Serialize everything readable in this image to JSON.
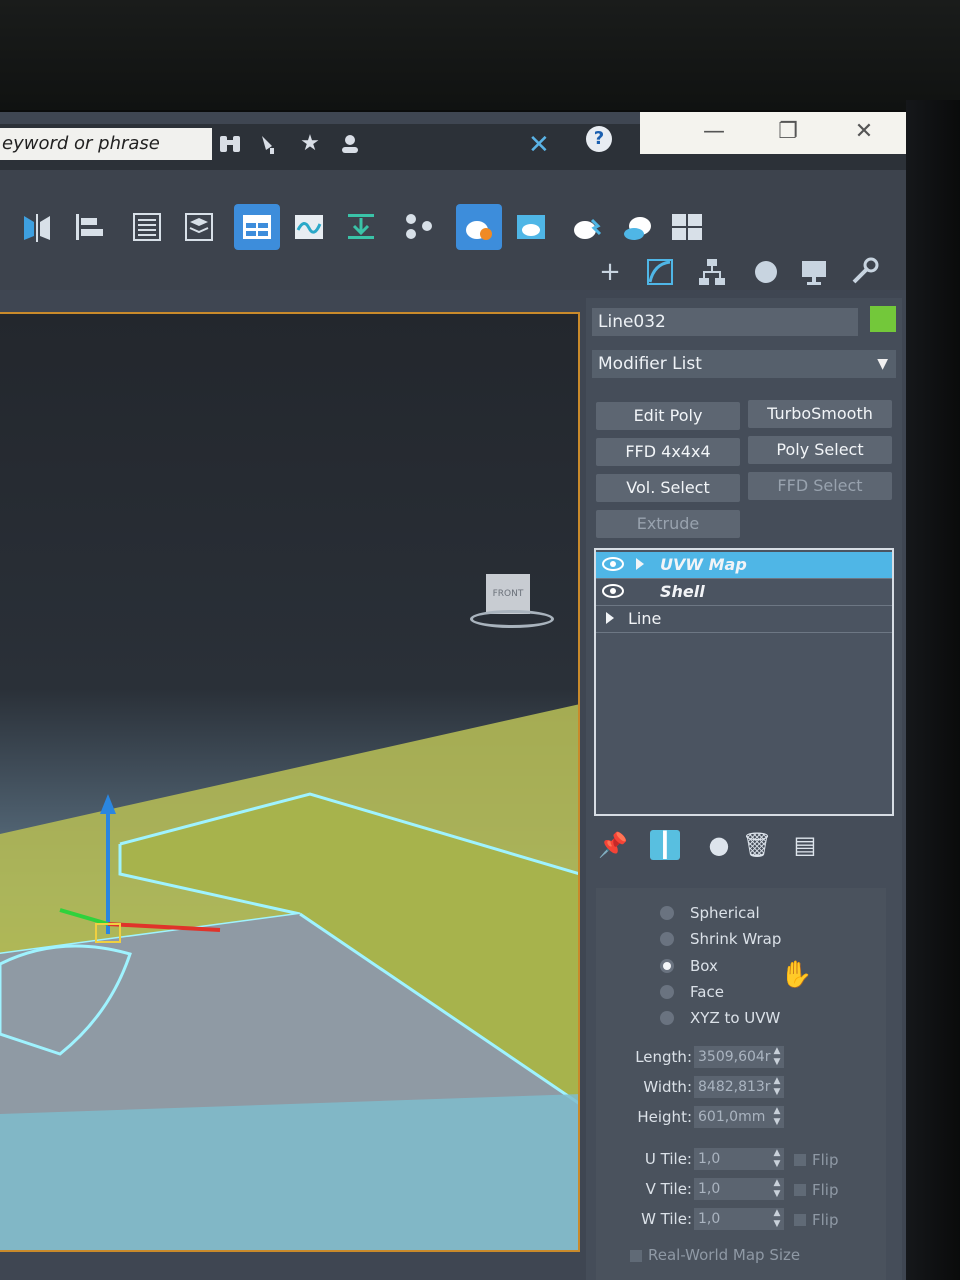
{
  "titlebar": {
    "search_placeholder": "eyword or phrase",
    "icons": [
      "binoculars-icon",
      "satellite-icon",
      "star-icon",
      "user-icon"
    ],
    "help_label": "?"
  },
  "window_controls": {
    "minimize": "—",
    "maximize": "❐",
    "close": "✕"
  },
  "command_panel": {
    "object_name": "Line032",
    "object_color": "#73c83a",
    "modifier_list_label": "Modifier List",
    "buttons": [
      {
        "label": "Edit Poly",
        "enabled": true
      },
      {
        "label": "TurboSmooth",
        "enabled": true
      },
      {
        "label": "FFD 4x4x4",
        "enabled": true
      },
      {
        "label": "Poly Select",
        "enabled": true
      },
      {
        "label": "Vol. Select",
        "enabled": true
      },
      {
        "label": "FFD Select",
        "enabled": false
      },
      {
        "label": "Extrude",
        "enabled": false
      }
    ],
    "stack": [
      {
        "label": "UVW Map",
        "selected": true,
        "eye": true,
        "expandable": true
      },
      {
        "label": "Shell",
        "selected": false,
        "eye": true,
        "expandable": false
      },
      {
        "label": "Line",
        "selected": false,
        "eye": false,
        "expandable": true
      }
    ]
  },
  "mapping": {
    "options": [
      {
        "label": "Spherical",
        "checked": false
      },
      {
        "label": "Shrink Wrap",
        "checked": false
      },
      {
        "label": "Box",
        "checked": true
      },
      {
        "label": "Face",
        "checked": false
      },
      {
        "label": "XYZ to UVW",
        "checked": false
      }
    ],
    "length_label": "Length:",
    "length_value": "3509,604r",
    "width_label": "Width:",
    "width_value": "8482,813r",
    "height_label": "Height:",
    "height_value": "601,0mm",
    "u_tile_label": "U Tile:",
    "u_tile_value": "1,0",
    "v_tile_label": "V Tile:",
    "v_tile_value": "1,0",
    "w_tile_label": "W Tile:",
    "w_tile_value": "1,0",
    "flip_label": "Flip",
    "real_world_label": "Real-World Map Size"
  },
  "viewport": {
    "viewcube_label": "FRONT"
  }
}
